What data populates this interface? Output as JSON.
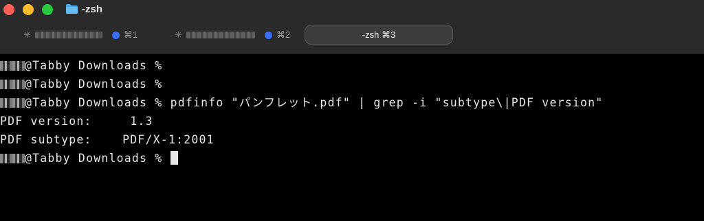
{
  "window": {
    "title": "-zsh",
    "folder_icon": "folder-icon",
    "traffic_lights": {
      "close": "#fe5f57",
      "minimize": "#febc2e",
      "maximize": "#28c840"
    }
  },
  "tabs": [
    {
      "icon": "spinner-icon",
      "shortcut": "⌘1",
      "active": false,
      "indicator_color": "#3b6ef5"
    },
    {
      "icon": "spinner-icon",
      "shortcut": "⌘2",
      "active": false,
      "indicator_color": "#3b6ef5"
    },
    {
      "label": "-zsh ⌘3",
      "active": true
    }
  ],
  "terminal": {
    "prompt_suffix": "@Tabby Downloads %",
    "lines": [
      {
        "type": "prompt",
        "command": ""
      },
      {
        "type": "prompt",
        "command": ""
      },
      {
        "type": "prompt",
        "command": "pdfinfo \"パンフレット.pdf\" | grep -i \"subtype\\|PDF version\""
      },
      {
        "type": "output",
        "text": "PDF version:     1.3"
      },
      {
        "type": "output",
        "text": "PDF subtype:    PDF/X-1:2001"
      },
      {
        "type": "prompt",
        "command": ""
      }
    ]
  }
}
